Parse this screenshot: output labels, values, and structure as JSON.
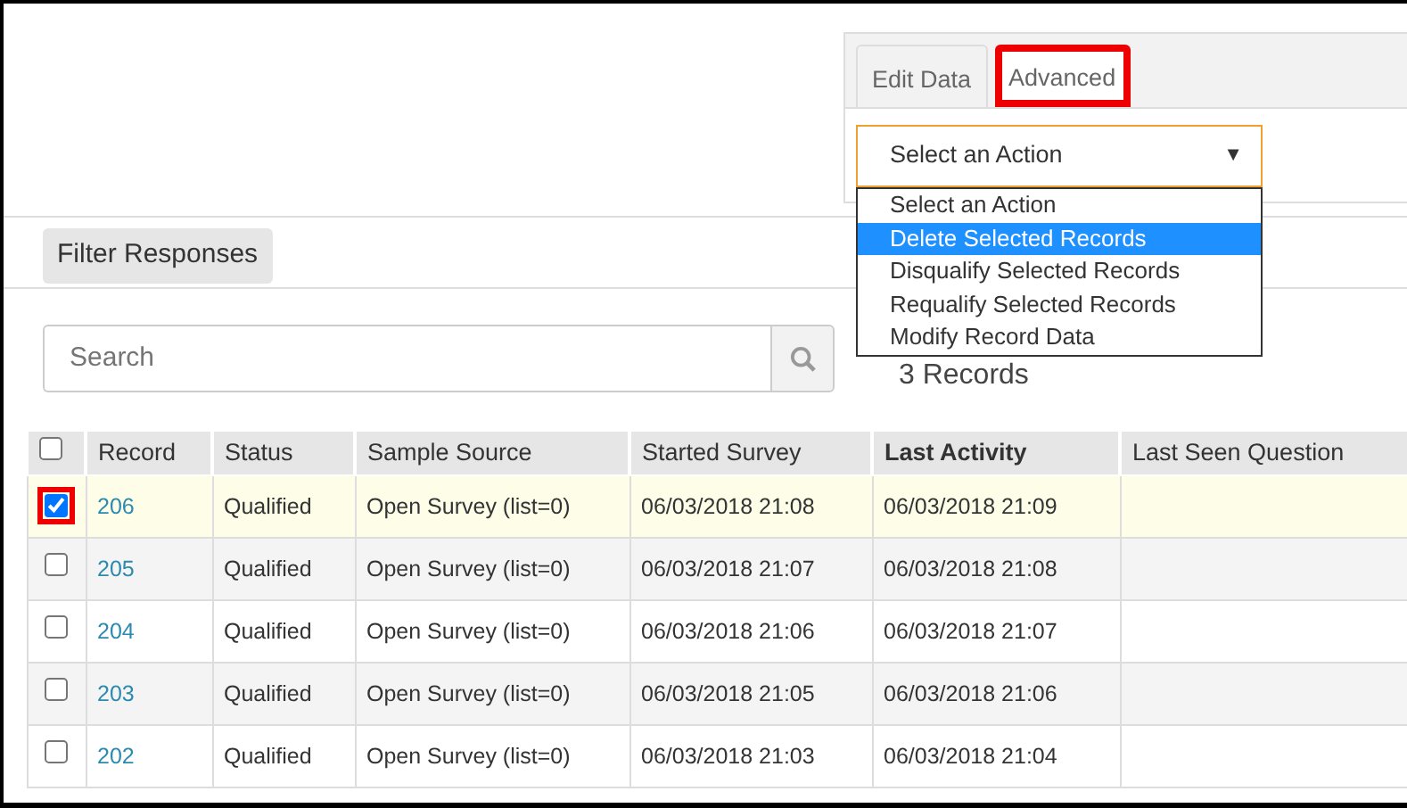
{
  "tabs": [
    {
      "label": "Edit Data",
      "selected": false,
      "annotated": false
    },
    {
      "label": "Advanced",
      "selected": true,
      "annotated": true
    }
  ],
  "action_select": {
    "value": "Select an Action",
    "caret": "▼",
    "options": [
      {
        "label": "Select an Action",
        "highlighted": false
      },
      {
        "label": "Delete Selected Records",
        "highlighted": true
      },
      {
        "label": "Disqualify Selected Records",
        "highlighted": false
      },
      {
        "label": "Requalify Selected Records",
        "highlighted": false
      },
      {
        "label": "Modify Record Data",
        "highlighted": false
      }
    ]
  },
  "filter_button": "Filter Responses",
  "search": {
    "placeholder": "Search"
  },
  "record_count": "3 Records",
  "table": {
    "select_all_checked": false,
    "columns": [
      {
        "label": "Record",
        "sorted": false
      },
      {
        "label": "Status",
        "sorted": false
      },
      {
        "label": "Sample Source",
        "sorted": false
      },
      {
        "label": "Started Survey",
        "sorted": false
      },
      {
        "label": "Last Activity",
        "sorted": true
      },
      {
        "label": "Last Seen Question",
        "sorted": false
      }
    ],
    "rows": [
      {
        "checked": true,
        "annotated": true,
        "cells": [
          "206",
          "Qualified",
          "Open Survey (list=0)",
          "06/03/2018 21:08",
          "06/03/2018 21:09",
          ""
        ]
      },
      {
        "checked": false,
        "annotated": false,
        "cells": [
          "205",
          "Qualified",
          "Open Survey (list=0)",
          "06/03/2018 21:07",
          "06/03/2018 21:08",
          ""
        ]
      },
      {
        "checked": false,
        "annotated": false,
        "cells": [
          "204",
          "Qualified",
          "Open Survey (list=0)",
          "06/03/2018 21:06",
          "06/03/2018 21:07",
          ""
        ]
      },
      {
        "checked": false,
        "annotated": false,
        "cells": [
          "203",
          "Qualified",
          "Open Survey (list=0)",
          "06/03/2018 21:05",
          "06/03/2018 21:06",
          ""
        ]
      },
      {
        "checked": false,
        "annotated": false,
        "cells": [
          "202",
          "Qualified",
          "Open Survey (list=0)",
          "06/03/2018 21:03",
          "06/03/2018 21:04",
          ""
        ]
      }
    ]
  }
}
